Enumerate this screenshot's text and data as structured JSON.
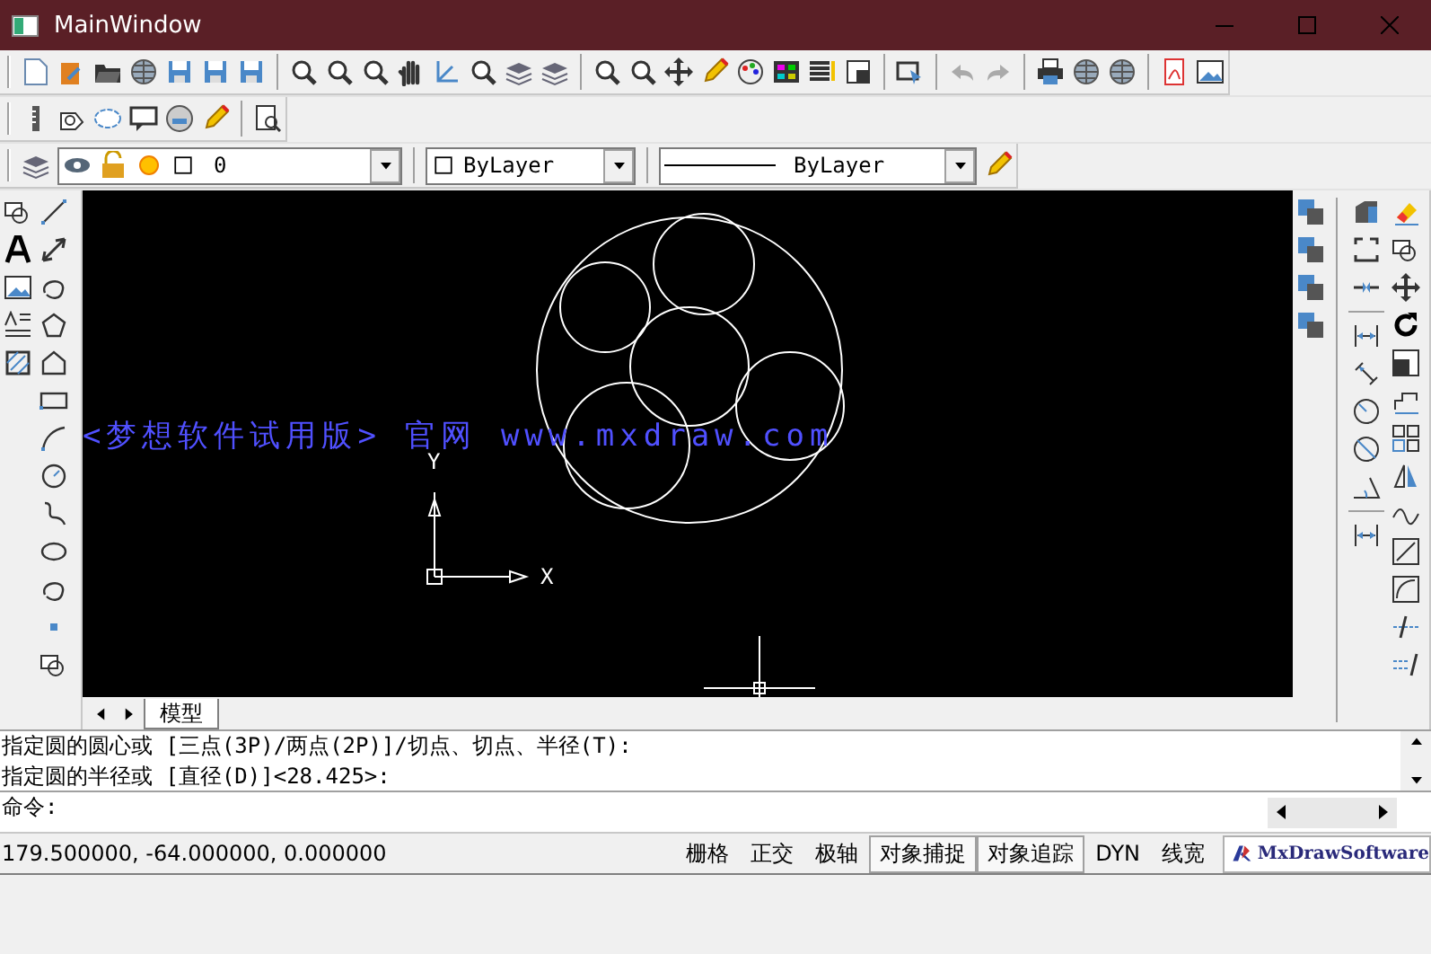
{
  "window": {
    "title": "MainWindow"
  },
  "layer_bar": {
    "layer": "0",
    "color_name": "ByLayer",
    "linetype": "ByLayer"
  },
  "canvas": {
    "watermark": "<梦想软件试用版> 官网 www.mxdraw.com",
    "y_label": "Y",
    "x_label": "X"
  },
  "layout_tabs": [
    {
      "label": "模型",
      "selected": true
    }
  ],
  "command_history": [
    "指定圆的圆心或 [三点(3P)/两点(2P)]/切点、切点、半径(T):",
    "指定圆的半径或 [直径(D)]<28.425>:"
  ],
  "command_prompt": "命令:",
  "status_bar": {
    "coordinates": "179.500000,  -64.000000,  0.000000",
    "toggles": [
      {
        "label": "栅格",
        "on": false
      },
      {
        "label": "正交",
        "on": false
      },
      {
        "label": "极轴",
        "on": false
      },
      {
        "label": "对象捕捉",
        "on": true
      },
      {
        "label": "对象追踪",
        "on": true
      },
      {
        "label": "DYN",
        "on": false
      },
      {
        "label": "线宽",
        "on": false
      }
    ],
    "logo": "MxDrawSoftware"
  }
}
